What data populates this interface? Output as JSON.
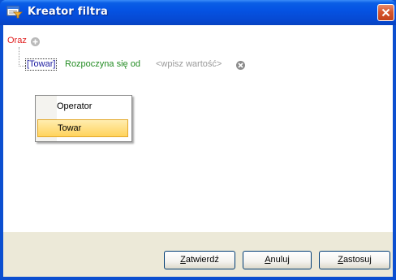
{
  "window": {
    "title": "Kreator filtra",
    "icon": "filter-window-icon"
  },
  "filter": {
    "group_operator": "Oraz",
    "condition": {
      "field": "[Towar]",
      "operator": "Rozpoczyna się od",
      "value_placeholder": "<wpisz wartość>"
    }
  },
  "context_menu": {
    "items": [
      {
        "label": "Operator",
        "highlighted": false
      },
      {
        "label": "Towar",
        "highlighted": true
      }
    ]
  },
  "buttons": {
    "ok": {
      "accel": "Z",
      "rest": "atwierdź"
    },
    "cancel": {
      "accel": "A",
      "rest": "nuluj"
    },
    "apply": {
      "accel": "Z",
      "rest": "astosuj"
    }
  },
  "colors": {
    "group_operator": "#e02020",
    "field": "#1a1aa0",
    "operator": "#238c23",
    "placeholder": "#9a9a9a",
    "title_bar": "#0553e3",
    "menu_highlight": "#ffd35c"
  }
}
